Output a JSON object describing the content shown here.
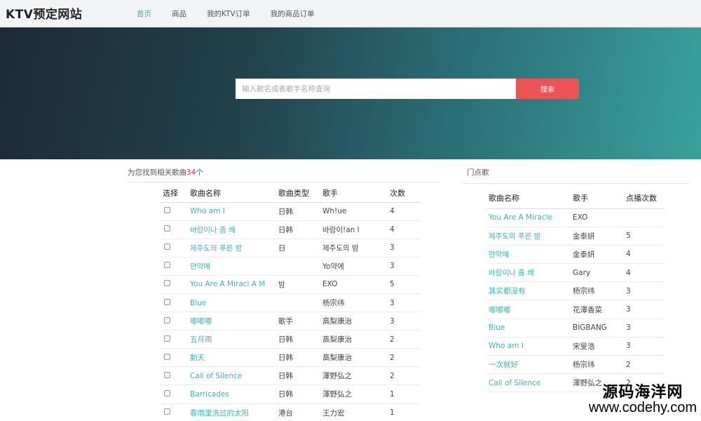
{
  "brand": "KTV预定网站",
  "nav": [
    {
      "label": "首页",
      "active": true
    },
    {
      "label": "商品",
      "active": false
    },
    {
      "label": "我的KTV订单",
      "active": false
    },
    {
      "label": "我的商品订单",
      "active": false
    }
  ],
  "search": {
    "placeholder": "输入歌名或者歌手名称查询",
    "value": "",
    "button_label": "搜索"
  },
  "results": {
    "prefix": "为您找到相关歌曲",
    "count": "34",
    "suffix": "个",
    "columns": [
      "选择",
      "歌曲名称",
      "歌曲类型",
      "歌手",
      "次数"
    ],
    "rows": [
      {
        "name": "Who am I",
        "type": "日韩",
        "singer": "Wh!ue",
        "times": "4"
      },
      {
        "name": "바람이나 좀 쐐",
        "type": "日韩",
        "singer": "바람이!an l",
        "times": "4"
      },
      {
        "name": "제주도의 푸른 밤",
        "type": "日",
        "singer": "제주도의 밤",
        "times": "3"
      },
      {
        "name": "만약에",
        "type": "",
        "singer": "Yo약에",
        "times": "3"
      },
      {
        "name": "You Are A Miracl A M",
        "type": "밤",
        "singer": "EXO",
        "times": "5"
      },
      {
        "name": "Blue",
        "type": "",
        "singer": "杨宗纬",
        "times": "3"
      },
      {
        "name": "嘟嘟嘟",
        "type": "歌手",
        "singer": "高梨康治",
        "times": "3"
      },
      {
        "name": "五月雨",
        "type": "日韩",
        "singer": "高梨康治",
        "times": "2"
      },
      {
        "name": "動天",
        "type": "日韩",
        "singer": "高梨康治",
        "times": "2"
      },
      {
        "name": "Call of Silence",
        "type": "日韩",
        "singer": "澤野弘之",
        "times": "2"
      },
      {
        "name": "Barricades",
        "type": "日韩",
        "singer": "澤野弘之",
        "times": "1"
      },
      {
        "name": "春雨里洗过的太阳",
        "type": "港台",
        "singer": "王力宏",
        "times": "1"
      }
    ]
  },
  "hot": {
    "title": "门点歌",
    "columns": [
      "歌曲名称",
      "歌手",
      "点播次数"
    ],
    "rows": [
      {
        "name": "You Are A Miracle",
        "singer": "EXO",
        "times": ""
      },
      {
        "name": "제주도의 푸른 밤",
        "singer": "金泰妍",
        "times": "5"
      },
      {
        "name": "만약에",
        "singer": "金泰妍",
        "times": "4"
      },
      {
        "name": "바람이나 좀 쐐",
        "singer": "Gary",
        "times": "4"
      },
      {
        "name": "其实都没有",
        "singer": "杨宗纬",
        "times": "3"
      },
      {
        "name": "嘟嘟嘟",
        "singer": "花澤香菜",
        "times": "3"
      },
      {
        "name": "Blue",
        "singer": "BIGBANG",
        "times": "3"
      },
      {
        "name": "Who am I",
        "singer": "宋旻浩",
        "times": "3"
      },
      {
        "name": "一次就好",
        "singer": "杨宗纬",
        "times": "2"
      },
      {
        "name": "Call of Silence",
        "singer": "澤野弘之",
        "times": "2"
      }
    ]
  },
  "watermark": {
    "line1": "源码海洋网",
    "line2": "www.codehy.com"
  },
  "colors": {
    "accent": "#3bb4b4",
    "search_button": "#ec5555",
    "count": "#e0353b"
  }
}
